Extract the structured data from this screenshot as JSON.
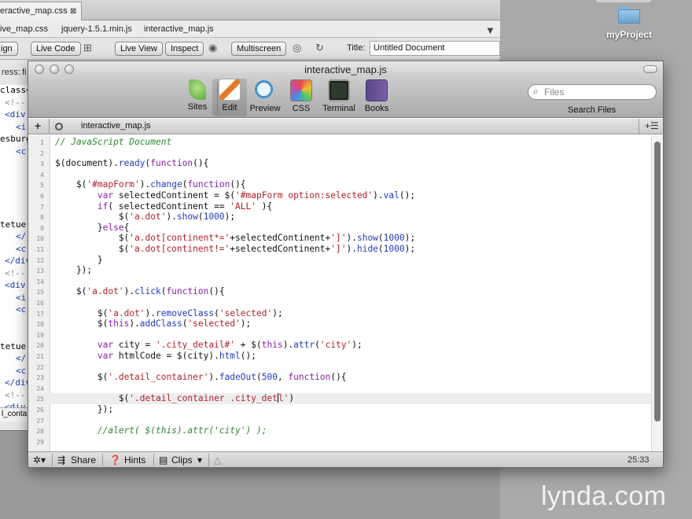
{
  "desktop": {
    "folder_label": "myProject"
  },
  "bg_window": {
    "tab_label": "eractive_map.css",
    "tab_close": "⊠",
    "related_files": [
      "ive_map.css",
      "jquery-1.5.1.min.js",
      "interactive_map.js"
    ],
    "buttons": {
      "design": "ign",
      "live_code": "Live Code",
      "live_view": "Live View",
      "inspect": "Inspect",
      "multiscreen": "Multiscreen"
    },
    "title_label": "Title:",
    "title_value": "Untitled Document",
    "address_label": "ress:",
    "address_value": "fi",
    "code_fragments": [
      "class=",
      "<!--",
      "<div",
      "<i",
      "esburg",
      "<c",
      "",
      "",
      "",
      "",
      "",
      "tetuer",
      "</",
      "<c",
      "</div",
      "<!--",
      "<div",
      "<i",
      "<c",
      "",
      "",
      "tetuer",
      "</",
      "<c",
      "</div",
      "<!--",
      "<div"
    ],
    "status": "l_conta"
  },
  "main_window": {
    "title": "interactive_map.js",
    "toolbar": [
      {
        "label": "Sites",
        "icon": "sites-leaf-icon",
        "color": "#5aa83a"
      },
      {
        "label": "Edit",
        "icon": "edit-pencil-icon",
        "color": "#e07b2a"
      },
      {
        "label": "Preview",
        "icon": "preview-magnifier-icon",
        "color": "#4a90c8"
      },
      {
        "label": "CSS",
        "icon": "css-palette-icon",
        "color": "#c84aa0"
      },
      {
        "label": "Terminal",
        "icon": "terminal-icon",
        "color": "#2e3a2e"
      },
      {
        "label": "Books",
        "icon": "books-icon",
        "color": "#7a5fa8"
      }
    ],
    "search": {
      "placeholder": "Files",
      "label": "Search Files"
    },
    "doc_tab": "interactive_map.js",
    "code_lines": [
      {
        "n": "1",
        "html": "<span class='tk-comment'>// JavaScript Document</span>"
      },
      {
        "n": "2",
        "html": ""
      },
      {
        "n": "3",
        "html": "$(document).<span class='tk-fn'>ready</span>(<span class='tk-kw'>function</span>(){"
      },
      {
        "n": "4",
        "html": ""
      },
      {
        "n": "5",
        "html": "    $(<span class='tk-str'>'#mapForm'</span>).<span class='tk-fn'>change</span>(<span class='tk-kw'>function</span>(){"
      },
      {
        "n": "6",
        "html": "        <span class='tk-kw'>var</span> selectedContinent = $(<span class='tk-str'>'#mapForm option:selected'</span>).<span class='tk-fn'>val</span>();"
      },
      {
        "n": "7",
        "html": "        <span class='tk-kw'>if</span>( selectedContinent == <span class='tk-str'>'ALL'</span> ){"
      },
      {
        "n": "8",
        "html": "            $(<span class='tk-str'>'a.dot'</span>).<span class='tk-fn'>show</span>(<span class='tk-num'>1000</span>);"
      },
      {
        "n": "9",
        "html": "        }<span class='tk-kw'>else</span>{"
      },
      {
        "n": "10",
        "html": "            $(<span class='tk-str'>'a.dot[continent*='</span>+selectedContinent+<span class='tk-str'>']'</span>).<span class='tk-fn'>show</span>(<span class='tk-num'>1000</span>);"
      },
      {
        "n": "11",
        "html": "            $(<span class='tk-str'>'a.dot[continent!='</span>+selectedContinent+<span class='tk-str'>']'</span>).<span class='tk-fn'>hide</span>(<span class='tk-num'>1000</span>);"
      },
      {
        "n": "12",
        "html": "        }"
      },
      {
        "n": "13",
        "html": "    });"
      },
      {
        "n": "14",
        "html": ""
      },
      {
        "n": "15",
        "html": "    $(<span class='tk-str'>'a.dot'</span>).<span class='tk-fn'>click</span>(<span class='tk-kw'>function</span>(){"
      },
      {
        "n": "16",
        "html": ""
      },
      {
        "n": "17",
        "html": "        $(<span class='tk-str'>'a.dot'</span>).<span class='tk-fn'>removeClass</span>(<span class='tk-str'>'selected'</span>);"
      },
      {
        "n": "18",
        "html": "        $(<span class='tk-kw'>this</span>).<span class='tk-fn'>addClass</span>(<span class='tk-str'>'selected'</span>);"
      },
      {
        "n": "19",
        "html": ""
      },
      {
        "n": "20",
        "html": "        <span class='tk-kw'>var</span> city = <span class='tk-str'>'.city_detail#'</span> + $(<span class='tk-kw'>this</span>).<span class='tk-fn'>attr</span>(<span class='tk-str'>'city'</span>);"
      },
      {
        "n": "21",
        "html": "        <span class='tk-kw'>var</span> htmlCode = $(city).<span class='tk-fn'>html</span>();"
      },
      {
        "n": "22",
        "html": ""
      },
      {
        "n": "23",
        "html": "        $(<span class='tk-str'>'.detail_container'</span>).<span class='tk-fn'>fadeOut</span>(<span class='tk-num'>500</span>, <span class='tk-kw'>function</span>(){"
      },
      {
        "n": "24",
        "html": ""
      },
      {
        "n": "25",
        "html": "            $(<span class='tk-str'>'.detail_container .city_det<span class=\"caret\"></span>l'</span>)"
      },
      {
        "n": "26",
        "html": "        });"
      },
      {
        "n": "27",
        "html": ""
      },
      {
        "n": "28",
        "html": "        <span class='tk-comment'>//alert( $(this).attr('city') );</span>"
      },
      {
        "n": "29",
        "html": ""
      }
    ],
    "current_line": 25,
    "status": {
      "share": "Share",
      "hints": "Hints",
      "clips": "Clips",
      "cursor_position": "25:33"
    }
  },
  "watermark": "lynda.com"
}
